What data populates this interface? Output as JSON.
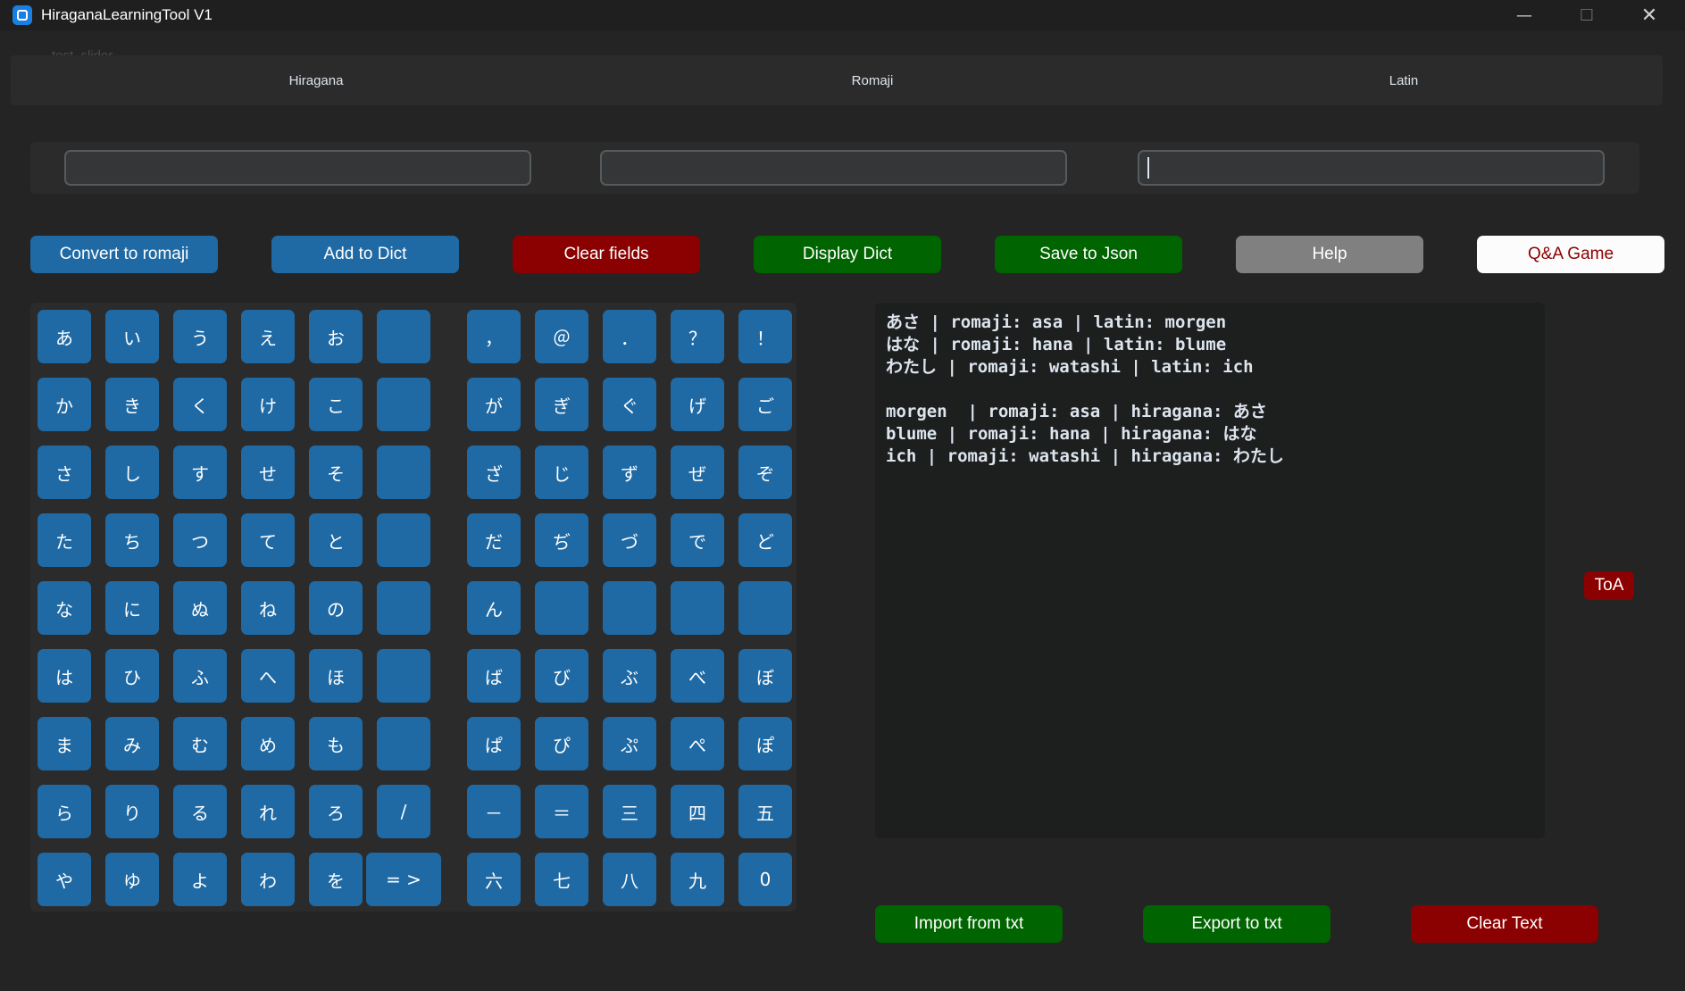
{
  "window": {
    "title": "HiraganaLearningTool V1",
    "controls": {
      "minimize": "—",
      "maximize": "☐",
      "close": "✕"
    },
    "icon": "app-icon"
  },
  "ghost_labels": {
    "slider": "test_slider"
  },
  "tabs": [
    "Hiragana",
    "Romaji",
    "Latin"
  ],
  "fields": {
    "hiragana": "",
    "romaji": "",
    "latin": ""
  },
  "buttons": {
    "convert": "Convert to romaji",
    "add": "Add to Dict",
    "clear_fields": "Clear fields",
    "display": "Display Dict",
    "save": "Save to Json",
    "help": "Help",
    "game": "Q&A Game",
    "toa": "ToA",
    "import": "Import from txt",
    "export": "Export to txt",
    "clear_text": "Clear Text"
  },
  "keypad": [
    [
      "あ",
      "い",
      "う",
      "え",
      "お",
      "",
      "，",
      "＠",
      "．",
      "？",
      "！"
    ],
    [
      "か",
      "き",
      "く",
      "け",
      "こ",
      "",
      "が",
      "ぎ",
      "ぐ",
      "げ",
      "ご"
    ],
    [
      "さ",
      "し",
      "す",
      "せ",
      "そ",
      "",
      "ざ",
      "じ",
      "ず",
      "ぜ",
      "ぞ"
    ],
    [
      "た",
      "ち",
      "つ",
      "て",
      "と",
      "",
      "だ",
      "ぢ",
      "づ",
      "で",
      "ど"
    ],
    [
      "な",
      "に",
      "ぬ",
      "ね",
      "の",
      "",
      "ん",
      "",
      "",
      "",
      ""
    ],
    [
      "は",
      "ひ",
      "ふ",
      "へ",
      "ほ",
      "",
      "ば",
      "び",
      "ぶ",
      "べ",
      "ぼ"
    ],
    [
      "ま",
      "み",
      "む",
      "め",
      "も",
      "",
      "ぱ",
      "ぴ",
      "ぷ",
      "ぺ",
      "ぽ"
    ],
    [
      "ら",
      "り",
      "る",
      "れ",
      "ろ",
      "/",
      "－",
      "＝",
      "三",
      "四",
      "五"
    ],
    [
      "や",
      "ゆ",
      "よ",
      "わ",
      "を",
      "= >",
      "六",
      "七",
      "八",
      "九",
      "0"
    ]
  ],
  "output_lines": [
    "あさ | romaji: asa | latin: morgen",
    "はな | romaji: hana | latin: blume",
    "わたし | romaji: watashi | latin: ich",
    "",
    "morgen  | romaji: asa | hiragana: あさ",
    "blume | romaji: hana | hiragana: はな",
    "ich | romaji: watashi | hiragana: わたし"
  ],
  "colors": {
    "blue": "#1f6aa5",
    "red": "#8b0000",
    "green": "#006400",
    "grey": "#808080",
    "background": "#242424"
  }
}
